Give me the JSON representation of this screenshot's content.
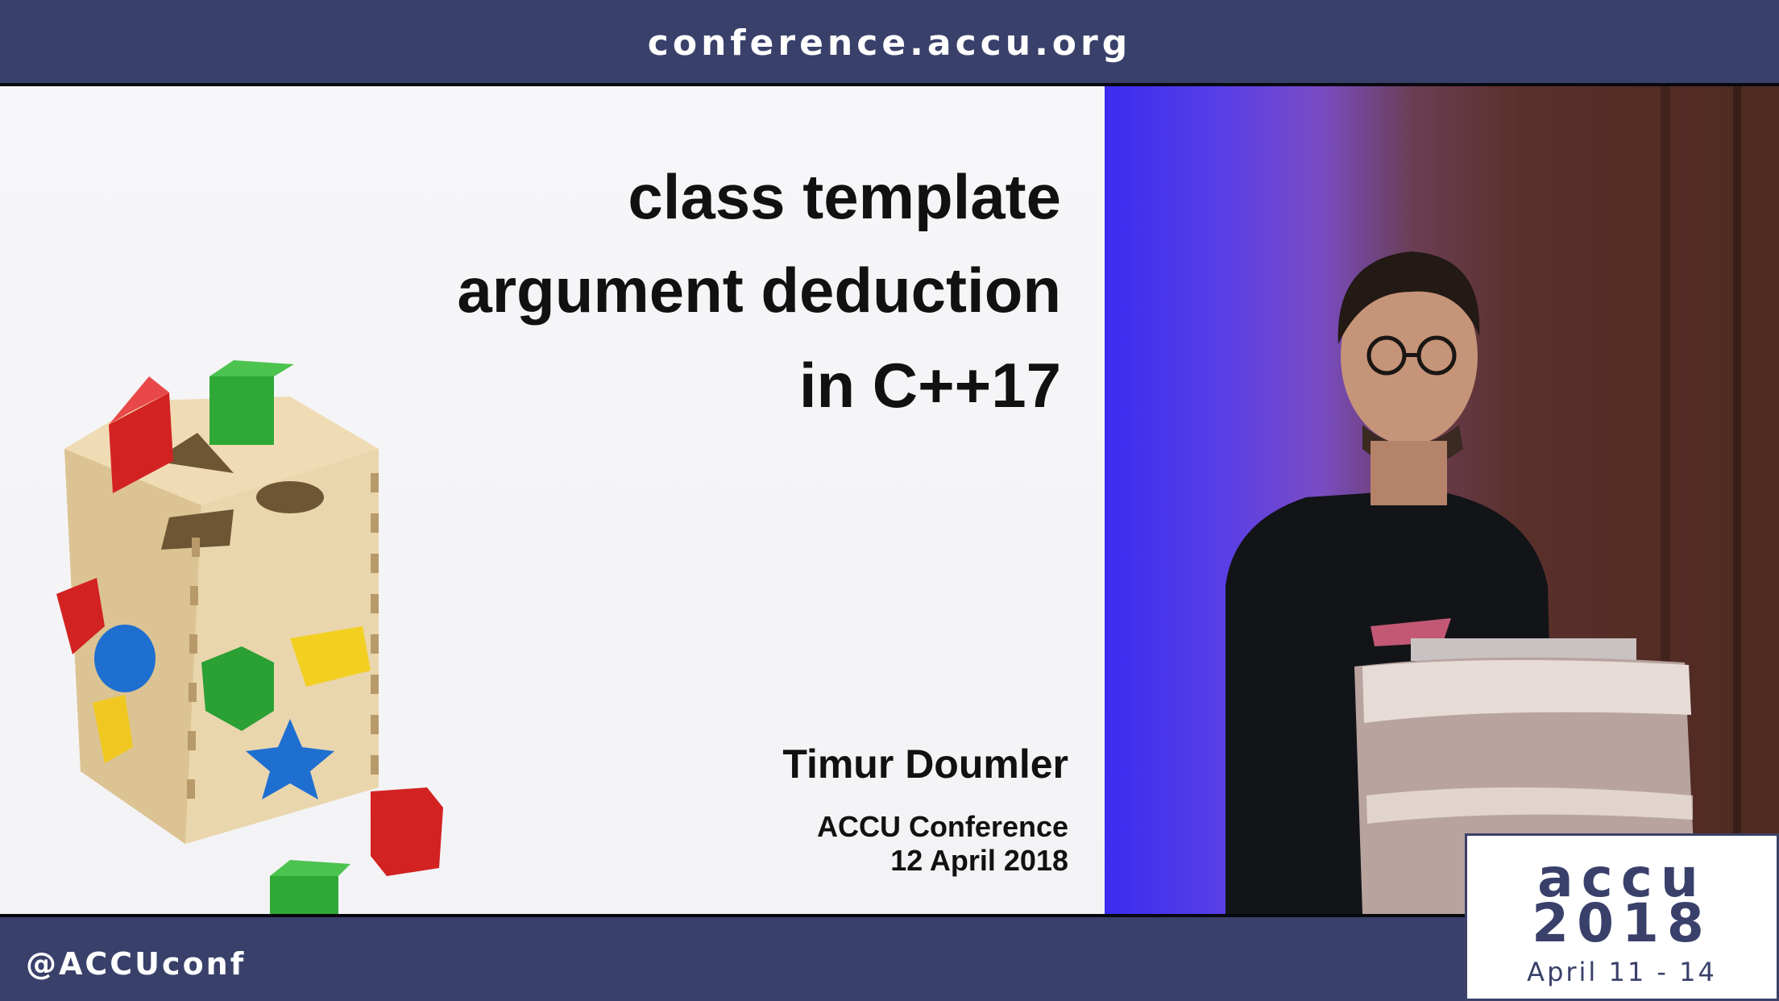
{
  "header": {
    "url": "conference.accu.org"
  },
  "slide": {
    "title_lines": [
      "class template",
      "argument deduction",
      "in C++17"
    ],
    "speaker": "Timur Doumler",
    "event": "ACCU Conference",
    "date": "12 April 2018",
    "illustration": "wooden-shape-sorter-cube-icon"
  },
  "footer": {
    "handle": "@ACCUconf",
    "badge": {
      "line1": "accu",
      "line2": "2018",
      "dates": "April 11 - 14"
    }
  },
  "colors": {
    "bar": "#39406a",
    "slide_bg": "#f4f4f6",
    "stage_blue": "#3a2cf0"
  }
}
